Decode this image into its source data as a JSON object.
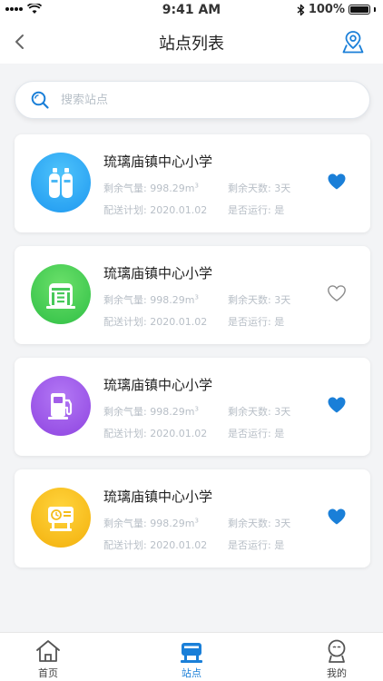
{
  "status_bar": {
    "time": "9:41 AM",
    "battery": "100%"
  },
  "nav": {
    "title": "站点列表"
  },
  "search": {
    "placeholder": "搜索站点"
  },
  "labels": {
    "gas": "剩余气量:",
    "gas_unit": "m",
    "gas_unit_sup": "3",
    "days": "剩余天数:",
    "plan": "配送计划:",
    "running": "是否运行:"
  },
  "stations": [
    {
      "name": "琉璃庙镇中心小学",
      "gas": "998.29",
      "days": "3天",
      "plan": "2020.01.02",
      "running": "是",
      "icon": "gas-cylinders-icon",
      "color": "#1e98f0",
      "favorited": true
    },
    {
      "name": "琉璃庙镇中心小学",
      "gas": "998.29",
      "days": "3天",
      "plan": "2020.01.02",
      "running": "是",
      "icon": "gas-tank-building-icon",
      "color": "#31c64a",
      "favorited": false
    },
    {
      "name": "琉璃庙镇中心小学",
      "gas": "998.29",
      "days": "3天",
      "plan": "2020.01.02",
      "running": "是",
      "icon": "fuel-pump-icon",
      "color": "#9b4fe6",
      "favorited": true
    },
    {
      "name": "琉璃庙镇中心小学",
      "gas": "998.29",
      "days": "3天",
      "plan": "2020.01.02",
      "running": "是",
      "icon": "gas-meter-icon",
      "color": "#f5b90f",
      "favorited": true
    }
  ],
  "tabs": [
    {
      "label": "首页",
      "icon": "home-icon",
      "active": false
    },
    {
      "label": "站点",
      "icon": "station-icon",
      "active": true
    },
    {
      "label": "我的",
      "icon": "profile-icon",
      "active": false
    }
  ],
  "colors": {
    "accent": "#1a7fd8",
    "heart": "#1a7fd8"
  }
}
